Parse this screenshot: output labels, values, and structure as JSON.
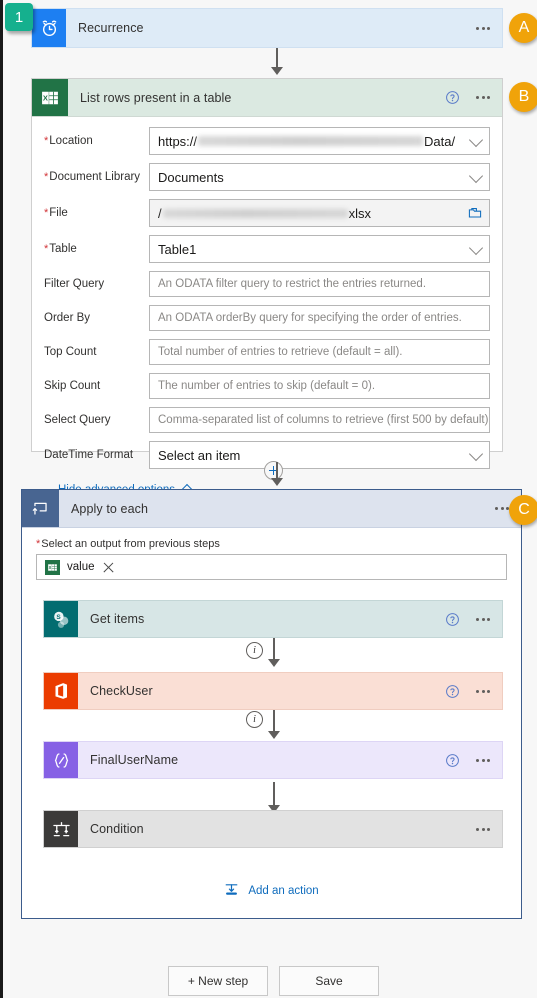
{
  "annotations": {
    "step_marker": "1",
    "badge_a": "A",
    "badge_b": "B",
    "badge_c": "C"
  },
  "trigger": {
    "title": "Recurrence",
    "icon": "alarm-clock-icon",
    "icon_color": "#1d7ff2",
    "header_color": "#deebf7"
  },
  "list_rows": {
    "title": "List rows present in a table",
    "icon": "excel-icon",
    "icon_color": "#217346",
    "header_color": "#dbe9e1",
    "fields": [
      {
        "label": "Location",
        "required": true,
        "value": "https://",
        "value_suffix": "Data/",
        "redacted": true,
        "control": "dropdown"
      },
      {
        "label": "Document Library",
        "required": true,
        "value": "Documents",
        "control": "dropdown"
      },
      {
        "label": "File",
        "required": true,
        "value": "/",
        "value_suffix": "xlsx",
        "redacted": true,
        "control": "folder-picker"
      },
      {
        "label": "Table",
        "required": true,
        "value": "Table1",
        "control": "dropdown"
      },
      {
        "label": "Filter Query",
        "required": false,
        "placeholder": "An ODATA filter query to restrict the entries returned.",
        "control": "text"
      },
      {
        "label": "Order By",
        "required": false,
        "placeholder": "An ODATA orderBy query for specifying the order of entries.",
        "control": "text"
      },
      {
        "label": "Top Count",
        "required": false,
        "placeholder": "Total number of entries to retrieve (default = all).",
        "control": "text"
      },
      {
        "label": "Skip Count",
        "required": false,
        "placeholder": "The number of entries to skip (default = 0).",
        "control": "text"
      },
      {
        "label": "Select Query",
        "required": false,
        "placeholder": "Comma-separated list of columns to retrieve (first 500 by default).",
        "control": "text"
      },
      {
        "label": "DateTime Format",
        "required": false,
        "placeholder": "Select an item",
        "control": "dropdown"
      }
    ],
    "advanced_link": "Hide advanced options"
  },
  "apply_to_each": {
    "title": "Apply to each",
    "icon": "loop-icon",
    "icon_color": "#486591",
    "header_color": "#dde3ee",
    "output_label": "Select an output from previous steps",
    "output_required": true,
    "token": {
      "text": "value",
      "icon": "excel-icon",
      "remove": "remove-token-icon"
    },
    "add_action_label": "Add an action",
    "actions": [
      {
        "title": "Get items",
        "icon": "sharepoint-icon",
        "icon_color": "#036c70",
        "header_color": "#d7e6e6",
        "has_help": true
      },
      {
        "title": "CheckUser",
        "icon": "office365-icon",
        "icon_color": "#eb3c00",
        "header_color": "#fadfd5",
        "has_help": true
      },
      {
        "title": "FinalUserName",
        "icon": "expression-icon",
        "icon_color": "#8661e5",
        "header_color": "#ece7fb",
        "has_help": true
      },
      {
        "title": "Condition",
        "icon": "condition-icon",
        "icon_color": "#3b3a39",
        "header_color": "#e2e2e2",
        "has_help": false
      }
    ]
  },
  "footer": {
    "new_step": "+ New step",
    "save": "Save"
  }
}
